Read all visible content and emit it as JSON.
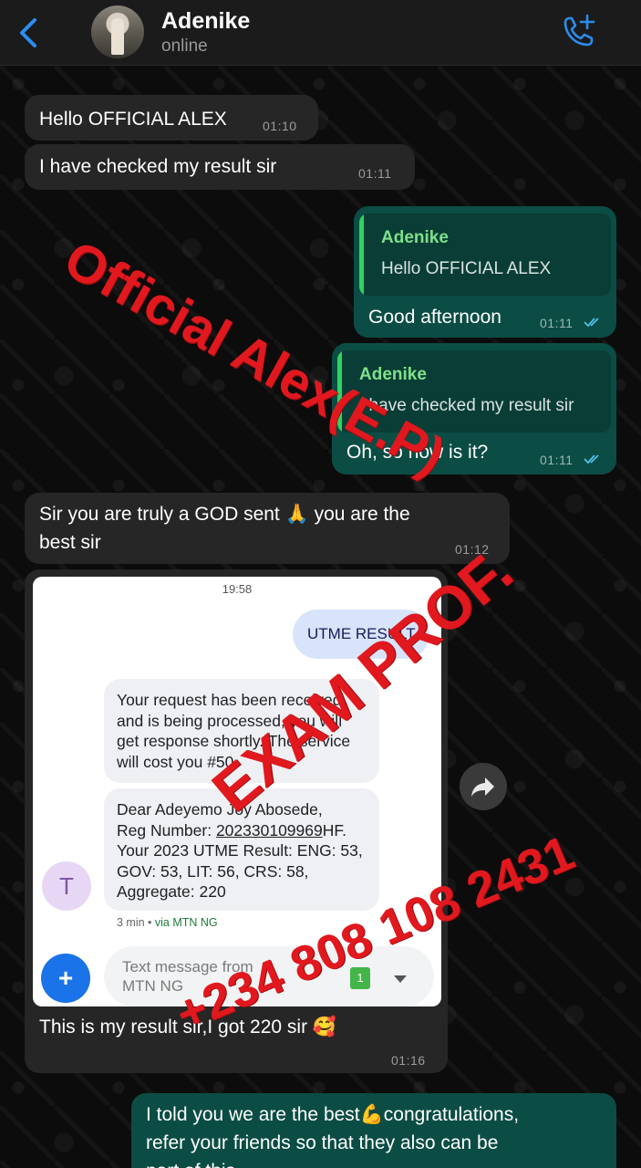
{
  "header": {
    "contact_name": "Adenike",
    "status": "online"
  },
  "messages": {
    "m1": {
      "text": "Hello OFFICIAL ALEX",
      "time": "01:10"
    },
    "m2": {
      "text": "I have checked my result sir",
      "time": "01:11"
    },
    "m3": {
      "quote_author": "Adenike",
      "quote_text": "Hello OFFICIAL ALEX",
      "text": "Good afternoon",
      "time": "01:11"
    },
    "m4": {
      "quote_author": "Adenike",
      "quote_text": "I have checked my result sir",
      "text": "Oh, so how is it?",
      "time": "01:11"
    },
    "m5": {
      "text_line1": "Sir you are truly a GOD sent 🙏 you are the",
      "text_line2": "best sir",
      "time": "01:12"
    },
    "m6": {
      "text": "This is my result sir,I got 220 sir 🥰",
      "time": "01:16"
    },
    "m7": {
      "text_line1": "I told you we are the best💪congratulations,",
      "text_line2": "refer your friends so that they also can be",
      "text_line3": "part of this"
    }
  },
  "sms_screenshot": {
    "status_time": "19:58",
    "sent_message": "UTME RESULT",
    "reply1": "Your request has been received and is being processed, you will get response shortly. The service will cost you #50",
    "reply2_line1": "Dear Adeyemo Joy Abosede,",
    "reply2_reg_label": "Reg Number: ",
    "reply2_reg_value": "202330109969",
    "reply2_reg_suffix": "HF.",
    "reply2_line3": "Your 2023 UTME Result: ENG: 53, GOV: 53, LIT: 56, CRS: 58, Aggregate: 220",
    "sender_initial": "T",
    "meta_time": "3 min",
    "meta_via": "via MTN NG",
    "input_placeholder": "Text message from MTN NG",
    "sim_label": "1",
    "fab_label": "+"
  },
  "watermarks": {
    "official": "Official Alex(E.P)",
    "exam": "EXAM PROF.",
    "phone": "+234 808 108 2431"
  },
  "colors": {
    "incoming_bubble": "#262626",
    "outgoing_bubble": "#0b4d44",
    "accent_blue": "#2b8ef0",
    "watermark_red": "#e1191f",
    "quote_bar": "#2fd360"
  }
}
